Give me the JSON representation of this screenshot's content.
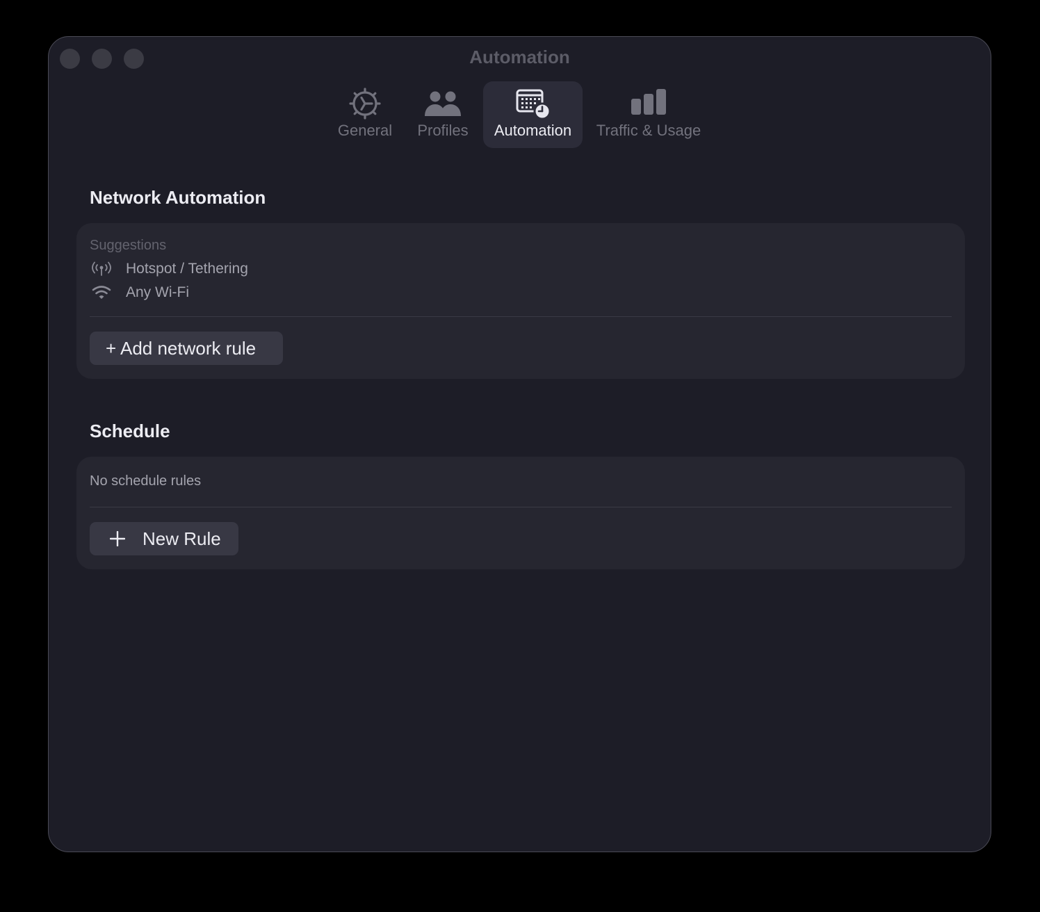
{
  "window": {
    "title": "Automation"
  },
  "toolbar": {
    "tabs": [
      {
        "label": "General",
        "icon": "gear-icon",
        "selected": false
      },
      {
        "label": "Profiles",
        "icon": "people-icon",
        "selected": false
      },
      {
        "label": "Automation",
        "icon": "calendar-clock-icon",
        "selected": true
      },
      {
        "label": "Traffic & Usage",
        "icon": "bar-chart-icon",
        "selected": false
      }
    ]
  },
  "network_automation": {
    "title": "Network Automation",
    "suggestions_label": "Suggestions",
    "suggestions": [
      {
        "label": "Hotspot / Tethering",
        "icon": "hotspot-icon"
      },
      {
        "label": "Any Wi-Fi",
        "icon": "wifi-icon"
      }
    ],
    "add_button_label": "+ Add network rule"
  },
  "schedule": {
    "title": "Schedule",
    "empty_text": "No schedule rules",
    "new_rule_label": "New Rule"
  }
}
